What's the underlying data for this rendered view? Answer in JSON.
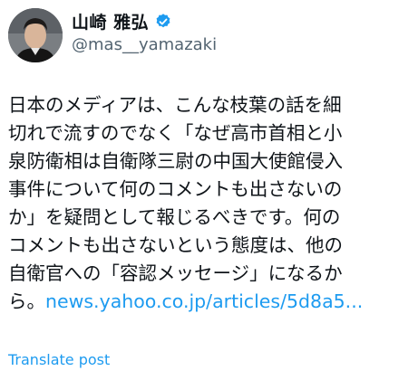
{
  "author": {
    "display_name": "山崎 雅弘",
    "handle": "@mas__yamazaki",
    "verified_icon": "verified-badge-icon",
    "avatar_icon": "profile-photo"
  },
  "post": {
    "lines": [
      "日本のメディアは、こんな枝葉の話を細",
      "切れで流すのでなく「なぜ高市首相と小",
      "泉防衛相は自衛隊三尉の中国大使館侵入",
      "事件について何のコメントも出さないの",
      "か」を疑問として報じるべきです。何の",
      "コメントも出さないという態度は、他の",
      "自衛官への「容認メッセージ」になるか"
    ],
    "last_line_prefix": "ら。",
    "link_text": "news.yahoo.co.jp/articles/5d8a5..."
  },
  "actions": {
    "translate_label": "Translate post"
  },
  "colors": {
    "link": "#1d9bf0",
    "text": "#0f1419",
    "secondary": "#536471"
  }
}
